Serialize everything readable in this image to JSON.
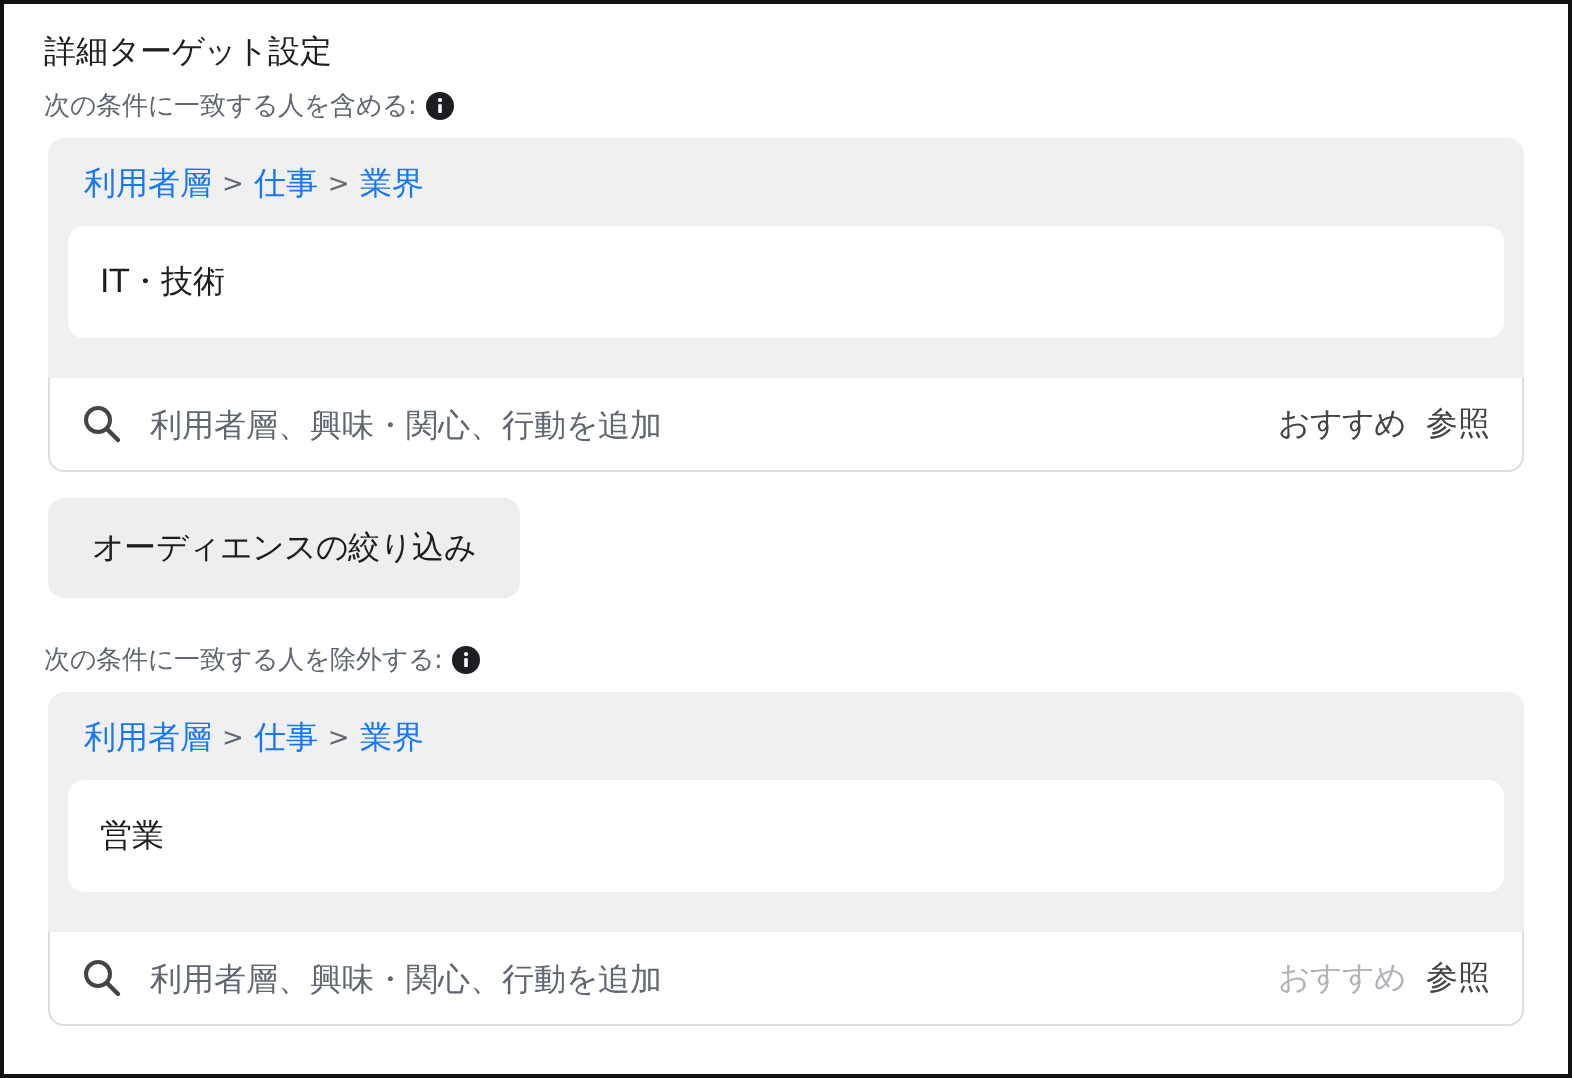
{
  "title": "詳細ターゲット設定",
  "sections": [
    {
      "heading": "次の条件に一致する人を含める:",
      "breadcrumb": [
        {
          "kind": "link",
          "label": "利用者層"
        },
        {
          "kind": "separator",
          "label": ">"
        },
        {
          "kind": "link",
          "label": "仕事"
        },
        {
          "kind": "separator",
          "label": ">"
        },
        {
          "kind": "link",
          "label": "業界"
        }
      ],
      "selected_item": "IT・技術",
      "search": {
        "placeholder": "利用者層、興味・関心、行動を追加",
        "suggestions": {
          "label": "おすすめ",
          "disabled": false
        },
        "browse": {
          "label": "参照",
          "disabled": false
        }
      }
    },
    {
      "heading": "次の条件に一致する人を除外する:",
      "breadcrumb": [
        {
          "kind": "link",
          "label": "利用者層"
        },
        {
          "kind": "separator",
          "label": ">"
        },
        {
          "kind": "link",
          "label": "仕事"
        },
        {
          "kind": "separator",
          "label": ">"
        },
        {
          "kind": "link",
          "label": "業界"
        }
      ],
      "selected_item": "営業",
      "search": {
        "placeholder": "利用者層、興味・関心、行動を追加",
        "suggestions": {
          "label": "おすすめ",
          "disabled": true
        },
        "browse": {
          "label": "参照",
          "disabled": false
        }
      }
    }
  ],
  "narrow_button": "オーディエンスの絞り込み"
}
